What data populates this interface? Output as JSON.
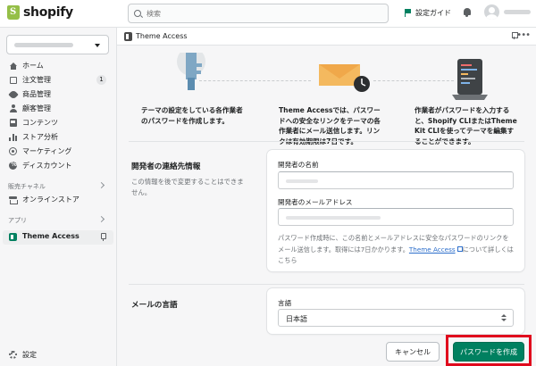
{
  "topbar": {
    "logo_text": "shopify",
    "search_placeholder": "検索",
    "setup_guide": "設定ガイド"
  },
  "sidebar": {
    "items": [
      {
        "label": "ホーム",
        "icon": "home-icon"
      },
      {
        "label": "注文管理",
        "icon": "orders-icon",
        "badge": "1"
      },
      {
        "label": "商品管理",
        "icon": "tag-icon"
      },
      {
        "label": "顧客管理",
        "icon": "customer-icon"
      },
      {
        "label": "コンテンツ",
        "icon": "content-icon"
      },
      {
        "label": "ストア分析",
        "icon": "analytics-icon"
      },
      {
        "label": "マーケティング",
        "icon": "marketing-icon"
      },
      {
        "label": "ディスカウント",
        "icon": "discount-icon"
      }
    ],
    "sales_channels_label": "販売チャネル",
    "online_store": "オンラインストア",
    "apps_label": "アプリ",
    "active_app": "Theme Access",
    "settings": "設定"
  },
  "app": {
    "title": "Theme Access"
  },
  "steps": [
    {
      "text": "テーマの設定をしている各作業者のパスワードを作成します。"
    },
    {
      "text": "Theme Accessでは、パスワードへの安全なリンクをテーマの各作業者にメール送信します。リンクは有効期限は7日です。"
    },
    {
      "text": "作業者がパスワードを入力すると、Shopify CLIまたはTheme Kit CLIを使ってテーマを編集することができます。"
    }
  ],
  "contact": {
    "heading": "開発者の連絡先情報",
    "subtext": "この情報を後で変更することはできません。",
    "name_label": "開発者の名前",
    "email_label": "開発者のメールアドレス",
    "help_text": "パスワード作成時に、この名前とメールアドレスに安全なパスワードのリンクをメール送信します。取得には7日かかります。",
    "link_text": "Theme Access",
    "help_text_after": "について詳しくはこちら"
  },
  "language": {
    "heading": "メールの言語",
    "label": "言語",
    "value": "日本語"
  },
  "buttons": {
    "cancel": "キャンセル",
    "create": "パスワードを作成"
  },
  "colors": {
    "primary": "#008060",
    "highlight": "#e0091d",
    "brand": "#95bf47"
  }
}
